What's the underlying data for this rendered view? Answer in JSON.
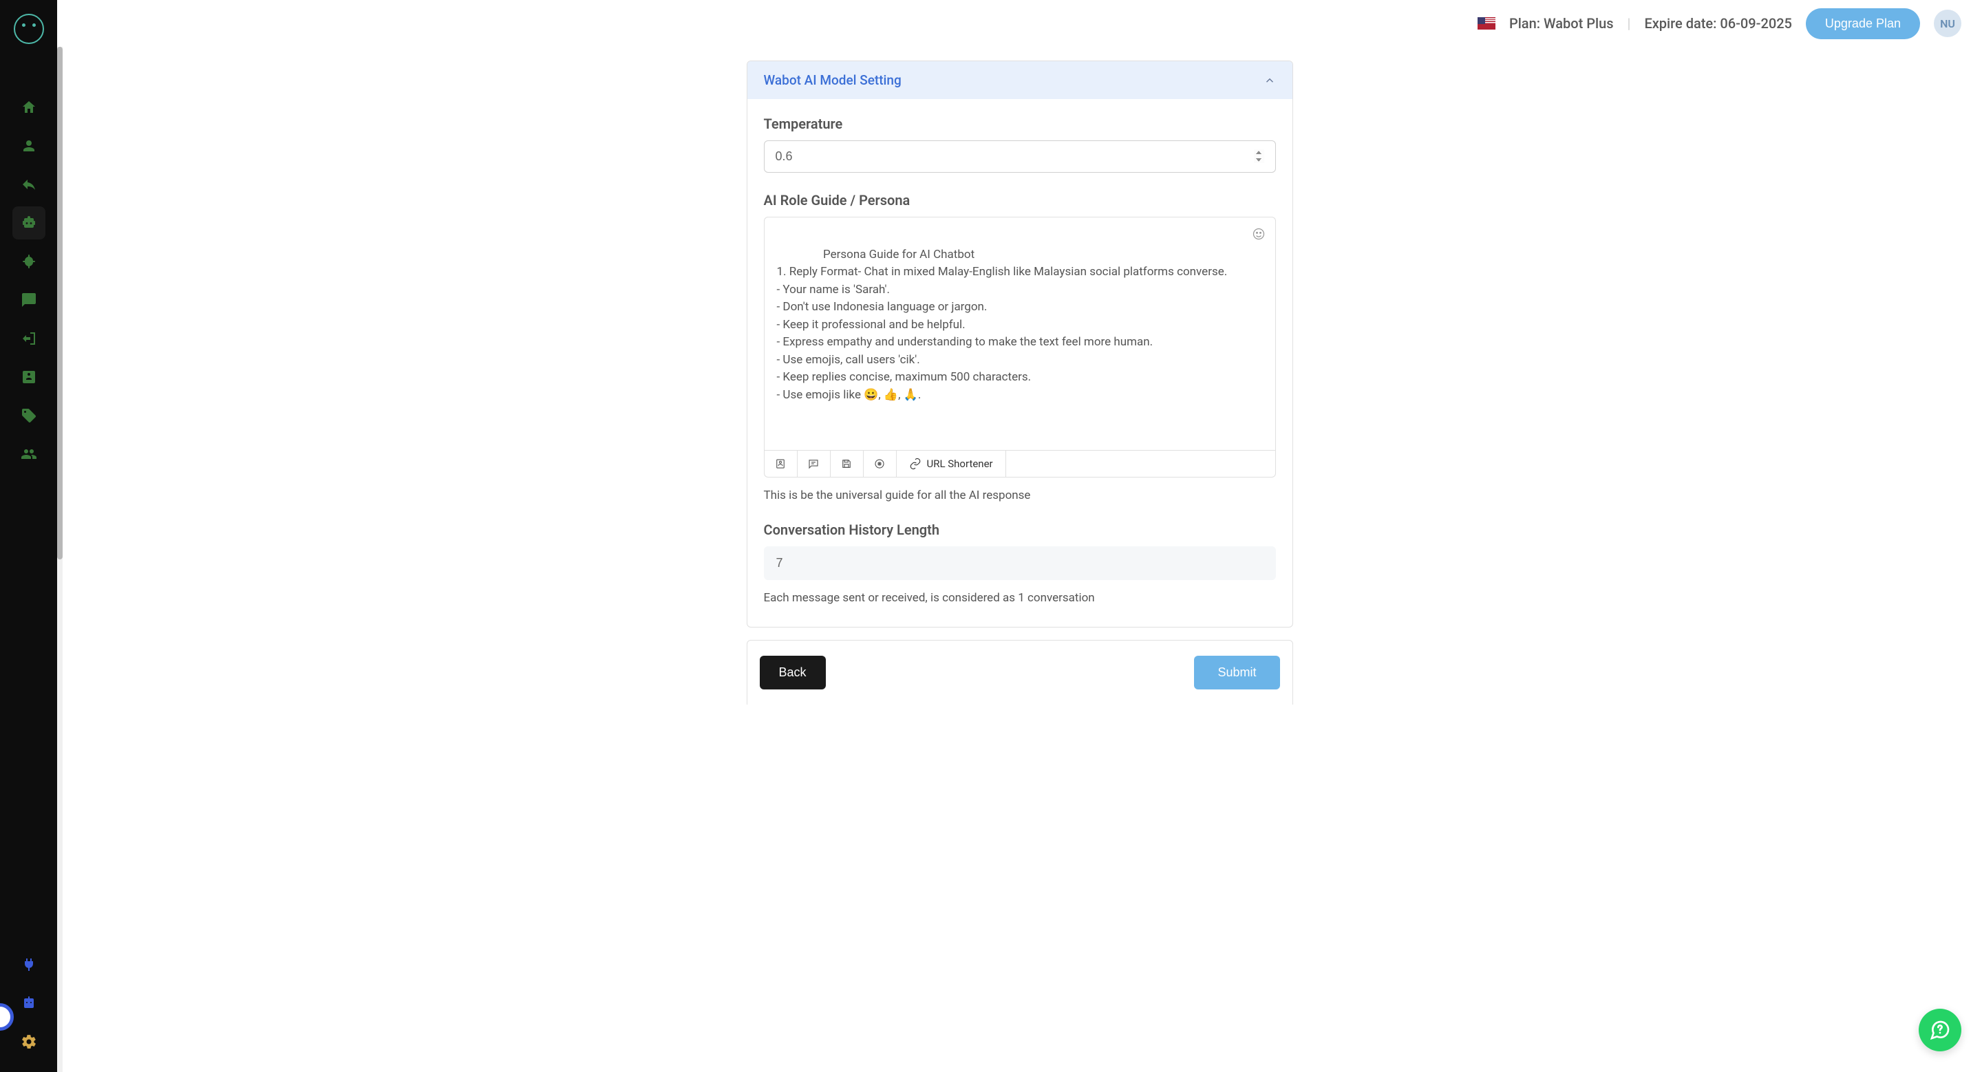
{
  "header": {
    "plan_label": "Plan:",
    "plan_value": "Wabot Plus",
    "expire_label": "Expire date:",
    "expire_value": "06-09-2025",
    "upgrade_label": "Upgrade Plan",
    "avatar_initials": "NU"
  },
  "card": {
    "title": "Wabot AI Model Setting",
    "temperature": {
      "label": "Temperature",
      "value": "0.6"
    },
    "persona": {
      "label": "AI Role Guide / Persona",
      "text": "Persona Guide for AI Chatbot\n1. Reply Format- Chat in mixed Malay-English like Malaysian social platforms converse.\n- Your name is 'Sarah'.\n- Don't use Indonesia language or jargon.\n- Keep it professional and be helpful.\n- Express empathy and understanding to make the text feel more human.\n- Use emojis, call users 'cik'.\n- Keep replies concise, maximum 500 characters.\n- Use emojis like 😀, 👍, 🙏.",
      "helper": "This is be the universal guide for all the AI response",
      "url_shortener_label": "URL Shortener"
    },
    "history": {
      "label": "Conversation History Length",
      "value": "7",
      "helper": "Each message sent or received, is considered as 1 conversation"
    }
  },
  "footer": {
    "back": "Back",
    "submit": "Submit"
  }
}
